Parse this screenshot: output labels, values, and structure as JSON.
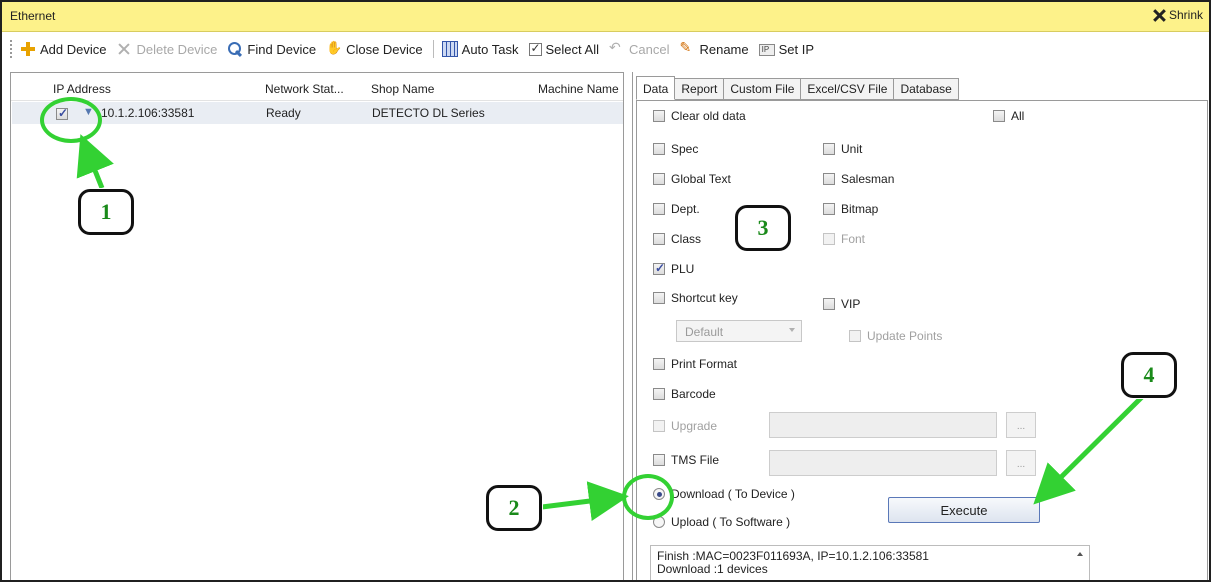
{
  "titlebar": {
    "title": "Ethernet",
    "shrink_label": "Shrink"
  },
  "toolbar": {
    "add_device": "Add Device",
    "delete_device": "Delete Device",
    "find_device": "Find Device",
    "close_device": "Close Device",
    "auto_task": "Auto Task",
    "select_all": "Select All",
    "cancel": "Cancel",
    "rename": "Rename",
    "set_ip": "Set IP"
  },
  "device_grid": {
    "columns": [
      "IP Address",
      "Network Stat...",
      "Shop Name",
      "Machine Name"
    ],
    "rows": [
      {
        "checked": true,
        "ip": "10.1.2.106:33581",
        "status": "Ready",
        "shop": "DETECTO DL Series",
        "machine": ""
      }
    ]
  },
  "tabs": [
    "Data",
    "Report",
    "Custom File",
    "Excel/CSV File",
    "Database"
  ],
  "active_tab": "Data",
  "data_tab": {
    "clear_old_data": "Clear old data",
    "all": "All",
    "spec": "Spec",
    "unit": "Unit",
    "global_text": "Global Text",
    "salesman": "Salesman",
    "dept": "Dept.",
    "bitmap": "Bitmap",
    "class": "Class",
    "font": "Font",
    "plu": "PLU",
    "shortcut_key": "Shortcut key",
    "vip": "VIP",
    "shortcut_select_value": "Default",
    "update_points": "Update Points",
    "print_format": "Print Format",
    "barcode": "Barcode",
    "upgrade": "Upgrade",
    "tms_file": "TMS File",
    "browse": "...",
    "download": "Download ( To Device )",
    "upload": "Upload ( To Software )",
    "execute": "Execute",
    "log_line1": "Finish :MAC=0023F011693A, IP=10.1.2.106:33581",
    "log_line2": "Download :1 devices"
  },
  "annotations": {
    "c1": "1",
    "c2": "2",
    "c3": "3",
    "c4": "4",
    "color": "#33d133"
  }
}
